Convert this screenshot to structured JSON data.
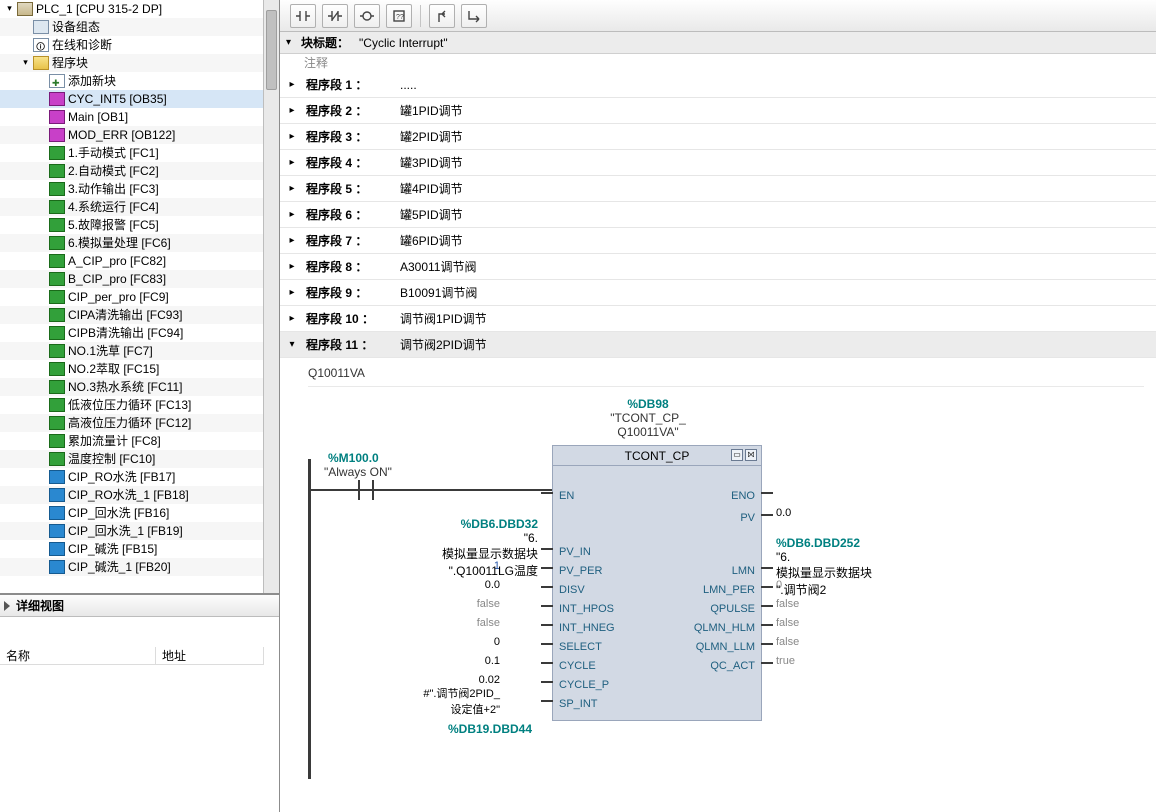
{
  "tree": {
    "root_label": "PLC_1 [CPU 315-2 DP]",
    "device_config": "设备组态",
    "online_diag": "在线和诊断",
    "program_blocks": "程序块",
    "add_new": "添加新块",
    "items": [
      {
        "label": "CYC_INT5 [OB35]",
        "kind": "ob",
        "sel": true
      },
      {
        "label": "Main [OB1]",
        "kind": "ob"
      },
      {
        "label": "MOD_ERR [OB122]",
        "kind": "ob"
      },
      {
        "label": "1.手动模式 [FC1]",
        "kind": "fc"
      },
      {
        "label": "2.自动模式 [FC2]",
        "kind": "fc"
      },
      {
        "label": "3.动作输出 [FC3]",
        "kind": "fc"
      },
      {
        "label": "4.系统运行 [FC4]",
        "kind": "fc"
      },
      {
        "label": "5.故障报警 [FC5]",
        "kind": "fc"
      },
      {
        "label": "6.模拟量处理 [FC6]",
        "kind": "fc"
      },
      {
        "label": "A_CIP_pro [FC82]",
        "kind": "fc"
      },
      {
        "label": "B_CIP_pro [FC83]",
        "kind": "fc"
      },
      {
        "label": "CIP_per_pro [FC9]",
        "kind": "fc"
      },
      {
        "label": "CIPA清洗输出 [FC93]",
        "kind": "fc"
      },
      {
        "label": "CIPB清洗输出 [FC94]",
        "kind": "fc"
      },
      {
        "label": "NO.1洗草 [FC7]",
        "kind": "fc"
      },
      {
        "label": "NO.2萃取 [FC15]",
        "kind": "fc"
      },
      {
        "label": "NO.3热水系统 [FC11]",
        "kind": "fc"
      },
      {
        "label": "低液位压力循环 [FC13]",
        "kind": "fc"
      },
      {
        "label": "高液位压力循环 [FC12]",
        "kind": "fc"
      },
      {
        "label": "累加流量计 [FC8]",
        "kind": "fc"
      },
      {
        "label": "温度控制 [FC10]",
        "kind": "fc"
      },
      {
        "label": "CIP_RO水洗 [FB17]",
        "kind": "fb"
      },
      {
        "label": "CIP_RO水洗_1 [FB18]",
        "kind": "fb"
      },
      {
        "label": "CIP_回水洗 [FB16]",
        "kind": "fb"
      },
      {
        "label": "CIP_回水洗_1 [FB19]",
        "kind": "fb"
      },
      {
        "label": "CIP_碱洗 [FB15]",
        "kind": "fb"
      },
      {
        "label": "CIP_碱洗_1 [FB20]",
        "kind": "fb"
      }
    ]
  },
  "detail": {
    "title": "详细视图",
    "col_name": "名称",
    "col_addr": "地址"
  },
  "block_header": {
    "label": "块标题：",
    "value": "\"Cyclic Interrupt\"",
    "comment": "注释"
  },
  "networks": [
    {
      "n": "程序段 1 ：",
      "t": "....."
    },
    {
      "n": "程序段 2 ：",
      "t": "罐1PID调节"
    },
    {
      "n": "程序段 3 ：",
      "t": "罐2PID调节"
    },
    {
      "n": "程序段 4 ：",
      "t": "罐3PID调节"
    },
    {
      "n": "程序段 5 ：",
      "t": "罐4PID调节"
    },
    {
      "n": "程序段 6 ：",
      "t": "罐5PID调节"
    },
    {
      "n": "程序段 7 ：",
      "t": "罐6PID调节"
    },
    {
      "n": "程序段 8 ：",
      "t": "A30011调节阀"
    },
    {
      "n": "程序段 9 ：",
      "t": "B10091调节阀"
    },
    {
      "n": "程序段 10 ：",
      "t": "调节阀1PID调节"
    },
    {
      "n": "程序段 11 ：",
      "t": "调节阀2PID调节",
      "open": true
    }
  ],
  "nw11": {
    "row_comment": "Q10011VA",
    "input_contact": {
      "addr": "%M100.0",
      "name": "\"Always ON\""
    },
    "instance": {
      "db": "%DB98",
      "name1": "\"TCONT_CP_",
      "name2": "Q10011VA\"",
      "type": "TCONT_CP"
    },
    "left_val_src": {
      "addr": "%DB6.DBD32",
      "line1": "\"6.",
      "line2": "模拟量显示数据块",
      "line3": "\".Q10011LG温度"
    },
    "right_val_src": {
      "addr": "%DB6.DBD252",
      "line1": "\"6.",
      "line2": "模拟量显示数据块",
      "line3": "\".调节阀2"
    },
    "pins_left": [
      {
        "name": "EN",
        "val": ""
      },
      {
        "name": "PV_IN",
        "val": ""
      },
      {
        "name": "PV_PER",
        "val": "1",
        "cls": "v-blue"
      },
      {
        "name": "DISV",
        "val": "0.0",
        "cls": "v-black"
      },
      {
        "name": "INT_HPOS",
        "val": "false",
        "cls": "v-gray"
      },
      {
        "name": "INT_HNEG",
        "val": "false",
        "cls": "v-gray"
      },
      {
        "name": "SELECT",
        "val": "0",
        "cls": "v-black"
      },
      {
        "name": "CYCLE",
        "val": "0.1",
        "cls": "v-black"
      },
      {
        "name": "CYCLE_P",
        "val": "0.02",
        "cls": "v-black"
      },
      {
        "name": "SP_INT",
        "val": "#\".调节阀2PID_\n设定值+2\"",
        "cls": "v-black",
        "multi": true
      }
    ],
    "pins_right": [
      {
        "name": "ENO",
        "val": ""
      },
      {
        "name": "PV",
        "val": "0.0",
        "cls": "v-black"
      },
      {
        "name": "LMN",
        "val": ""
      },
      {
        "name": "LMN_PER",
        "val": "0",
        "cls": "v-gray"
      },
      {
        "name": "QPULSE",
        "val": "false",
        "cls": "v-gray"
      },
      {
        "name": "QLMN_HLM",
        "val": "false",
        "cls": "v-gray"
      },
      {
        "name": "QLMN_LLM",
        "val": "false",
        "cls": "v-gray"
      },
      {
        "name": "QC_ACT",
        "val": "true",
        "cls": "v-gray"
      }
    ],
    "bottom_addr": "%DB19.DBD44"
  }
}
